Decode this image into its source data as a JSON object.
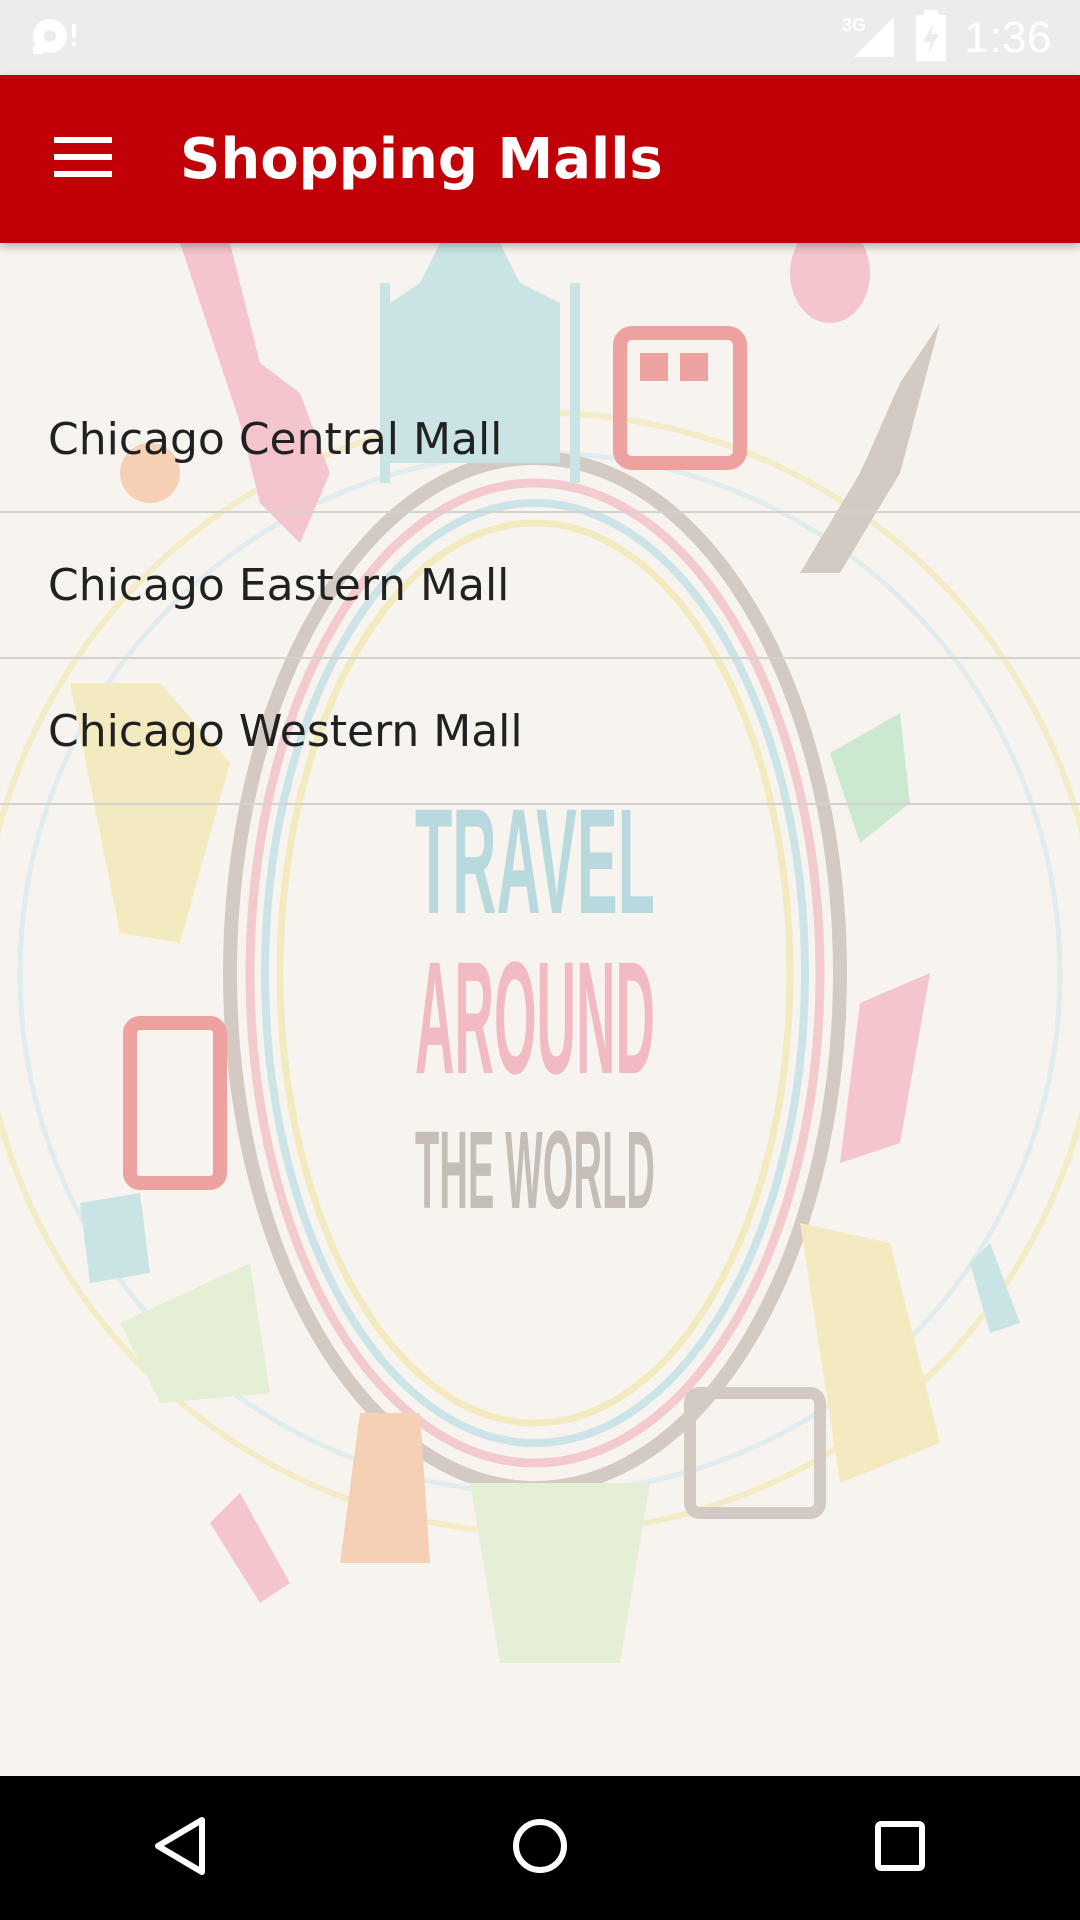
{
  "status_bar": {
    "time": "1:36",
    "network_type": "3G",
    "icons": [
      "notification-icon",
      "signal-icon",
      "battery-charging-icon"
    ]
  },
  "app_bar": {
    "title": "Shopping Malls",
    "menu_icon": "hamburger-menu-icon",
    "background_color": "#c00006"
  },
  "background": {
    "headline_line1": "TRAVEL",
    "headline_line2": "AROUND",
    "headline_line3": "THE WORLD"
  },
  "malls": [
    {
      "label": "Chicago Central Mall"
    },
    {
      "label": "Chicago Eastern Mall"
    },
    {
      "label": "Chicago Western Mall"
    }
  ],
  "nav_bar": {
    "icons": [
      "back-icon",
      "home-icon",
      "recents-icon"
    ]
  }
}
